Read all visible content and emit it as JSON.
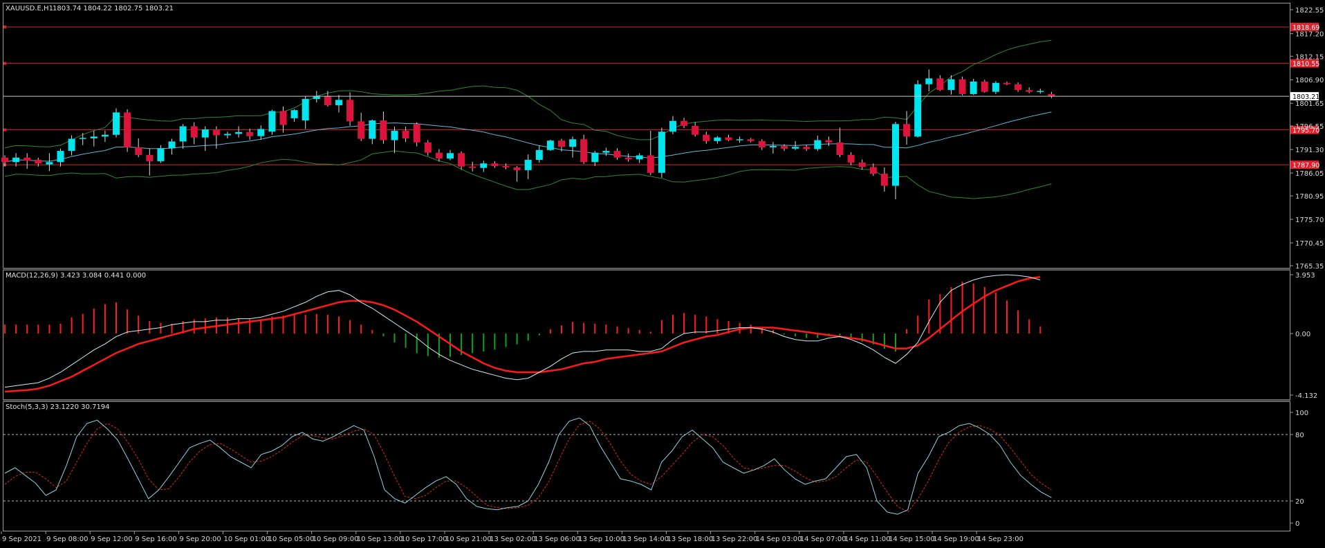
{
  "panels": {
    "main": {
      "symbol": "XAUUSD.E,H1",
      "ohlc": "1803.74 1804.22 1802.75 1803.21",
      "current_price_label": "1803.21",
      "price_scale": [
        "1822.55",
        "1817.20",
        "1812.15",
        "1806.90",
        "1801.65",
        "1796.55",
        "1791.30",
        "1786.05",
        "1780.95",
        "1775.70",
        "1770.45",
        "1765.35"
      ]
    },
    "macd": {
      "title": "MACD(12,26,9) 3.423 3.084 0.441 0.000",
      "scale": [
        "3.953",
        "0.00",
        "-4.132"
      ]
    },
    "stoch": {
      "title": "Stoch(5,3,3) 23.1220 30.7194",
      "scale": [
        "100",
        "80",
        "20",
        "0"
      ]
    },
    "time_axis": [
      "9 Sep 2021",
      "9 Sep 08:00",
      "9 Sep 12:00",
      "9 Sep 16:00",
      "9 Sep 20:00",
      "10 Sep 01:00",
      "10 Sep 05:00",
      "10 Sep 09:00",
      "10 Sep 13:00",
      "10 Sep 17:00",
      "10 Sep 21:00",
      "13 Sep 02:00",
      "13 Sep 06:00",
      "13 Sep 10:00",
      "13 Sep 14:00",
      "13 Sep 18:00",
      "13 Sep 22:00",
      "14 Sep 03:00",
      "14 Sep 07:00",
      "14 Sep 11:00",
      "14 Sep 15:00",
      "14 Sep 19:00",
      "14 Sep 23:00"
    ]
  },
  "colors": {
    "bull": "#00e5ee",
    "bear": "#dc143c",
    "hline": "#e0202a",
    "bands": "#2e8b2e",
    "ma": "#5fb8d8",
    "macd_pos": "#ff1e1e",
    "macd_neg": "#13a313",
    "signal": "#ff1a1a",
    "macd_line": "#cfeff5",
    "stoch_main": "#8fd6df",
    "stoch_signal": "#e02828",
    "grid_text": "#d8d8d8",
    "border": "#a0a0a0"
  },
  "chart_data": [
    {
      "type": "candlestick",
      "title": "XAUUSD.E,H1",
      "ylim": [
        1765.35,
        1822.55
      ],
      "horizontal_levels": [
        {
          "value": 1818.69,
          "label": "1818.69"
        },
        {
          "value": 1810.55,
          "label": "1810.55"
        },
        {
          "value": 1795.7,
          "label": "1795.70"
        },
        {
          "value": 1787.9,
          "label": "1787.90"
        }
      ],
      "candles": [
        {
          "o": 1789.5,
          "h": 1790.0,
          "l": 1787.5,
          "c": 1788.5
        },
        {
          "o": 1788.5,
          "h": 1790.5,
          "l": 1787.5,
          "c": 1789.5
        },
        {
          "o": 1789.5,
          "h": 1790.5,
          "l": 1787.0,
          "c": 1788.8
        },
        {
          "o": 1789.0,
          "h": 1789.5,
          "l": 1787.5,
          "c": 1788.2
        },
        {
          "o": 1788.0,
          "h": 1790.5,
          "l": 1786.5,
          "c": 1788.5
        },
        {
          "o": 1788.5,
          "h": 1791.5,
          "l": 1787.5,
          "c": 1791.0
        },
        {
          "o": 1791.0,
          "h": 1794.5,
          "l": 1790.0,
          "c": 1793.7
        },
        {
          "o": 1793.7,
          "h": 1795.0,
          "l": 1792.3,
          "c": 1793.9
        },
        {
          "o": 1793.8,
          "h": 1795.5,
          "l": 1792.0,
          "c": 1794.2
        },
        {
          "o": 1794.2,
          "h": 1795.5,
          "l": 1793.0,
          "c": 1794.6
        },
        {
          "o": 1794.6,
          "h": 1800.5,
          "l": 1794.0,
          "c": 1799.6
        },
        {
          "o": 1799.6,
          "h": 1800.3,
          "l": 1790.8,
          "c": 1791.8
        },
        {
          "o": 1791.8,
          "h": 1793.8,
          "l": 1789.6,
          "c": 1790.1
        },
        {
          "o": 1790.1,
          "h": 1791.5,
          "l": 1785.5,
          "c": 1788.7
        },
        {
          "o": 1788.7,
          "h": 1792.3,
          "l": 1788.3,
          "c": 1791.6
        },
        {
          "o": 1791.6,
          "h": 1793.7,
          "l": 1790.2,
          "c": 1793.1
        },
        {
          "o": 1793.1,
          "h": 1797.0,
          "l": 1791.5,
          "c": 1796.5
        },
        {
          "o": 1796.5,
          "h": 1797.4,
          "l": 1792.5,
          "c": 1794.0
        },
        {
          "o": 1794.0,
          "h": 1796.5,
          "l": 1791.0,
          "c": 1795.8
        },
        {
          "o": 1795.8,
          "h": 1796.5,
          "l": 1791.5,
          "c": 1794.5
        },
        {
          "o": 1794.5,
          "h": 1795.3,
          "l": 1793.8,
          "c": 1794.8
        },
        {
          "o": 1794.8,
          "h": 1796.5,
          "l": 1794.0,
          "c": 1795.2
        },
        {
          "o": 1795.2,
          "h": 1796.0,
          "l": 1793.5,
          "c": 1794.3
        },
        {
          "o": 1794.3,
          "h": 1796.7,
          "l": 1793.5,
          "c": 1795.9
        },
        {
          "o": 1795.3,
          "h": 1800.2,
          "l": 1794.6,
          "c": 1799.9
        },
        {
          "o": 1799.9,
          "h": 1800.9,
          "l": 1795.1,
          "c": 1796.8
        },
        {
          "o": 1798.3,
          "h": 1800.3,
          "l": 1797.5,
          "c": 1800.1
        },
        {
          "o": 1797.8,
          "h": 1803.2,
          "l": 1795.9,
          "c": 1802.6
        },
        {
          "o": 1802.6,
          "h": 1804.4,
          "l": 1801.8,
          "c": 1803.3
        },
        {
          "o": 1803.3,
          "h": 1804.4,
          "l": 1800.9,
          "c": 1801.2
        },
        {
          "o": 1801.2,
          "h": 1803.5,
          "l": 1799.6,
          "c": 1802.4
        },
        {
          "o": 1802.4,
          "h": 1804.1,
          "l": 1796.6,
          "c": 1797.6
        },
        {
          "o": 1797.6,
          "h": 1799.5,
          "l": 1793.2,
          "c": 1793.7
        },
        {
          "o": 1793.7,
          "h": 1798.0,
          "l": 1792.5,
          "c": 1797.8
        },
        {
          "o": 1797.8,
          "h": 1799.8,
          "l": 1792.6,
          "c": 1793.4
        },
        {
          "o": 1793.4,
          "h": 1796.4,
          "l": 1790.5,
          "c": 1795.5
        },
        {
          "o": 1795.5,
          "h": 1796.4,
          "l": 1793.0,
          "c": 1793.8
        },
        {
          "o": 1797.0,
          "h": 1797.4,
          "l": 1792.0,
          "c": 1792.9
        },
        {
          "o": 1792.9,
          "h": 1793.4,
          "l": 1789.9,
          "c": 1790.6
        },
        {
          "o": 1790.6,
          "h": 1791.4,
          "l": 1788.6,
          "c": 1789.3
        },
        {
          "o": 1789.3,
          "h": 1791.2,
          "l": 1788.9,
          "c": 1790.5
        },
        {
          "o": 1790.5,
          "h": 1790.9,
          "l": 1786.8,
          "c": 1787.5
        },
        {
          "o": 1787.5,
          "h": 1788.6,
          "l": 1786.4,
          "c": 1787.2
        },
        {
          "o": 1787.2,
          "h": 1788.8,
          "l": 1786.3,
          "c": 1788.2
        },
        {
          "o": 1788.2,
          "h": 1788.7,
          "l": 1787.2,
          "c": 1787.6
        },
        {
          "o": 1787.6,
          "h": 1788.2,
          "l": 1786.9,
          "c": 1787.3
        },
        {
          "o": 1787.3,
          "h": 1787.6,
          "l": 1784.1,
          "c": 1786.7
        },
        {
          "o": 1786.7,
          "h": 1790.2,
          "l": 1784.7,
          "c": 1789.0
        },
        {
          "o": 1789.0,
          "h": 1792.2,
          "l": 1788.4,
          "c": 1791.2
        },
        {
          "o": 1791.2,
          "h": 1793.5,
          "l": 1791.0,
          "c": 1793.3
        },
        {
          "o": 1793.3,
          "h": 1793.7,
          "l": 1790.9,
          "c": 1791.9
        },
        {
          "o": 1791.9,
          "h": 1794.2,
          "l": 1789.5,
          "c": 1793.6
        },
        {
          "o": 1793.6,
          "h": 1794.6,
          "l": 1788.1,
          "c": 1788.5
        },
        {
          "o": 1788.5,
          "h": 1791.0,
          "l": 1787.6,
          "c": 1790.6
        },
        {
          "o": 1790.6,
          "h": 1791.7,
          "l": 1789.9,
          "c": 1791.0
        },
        {
          "o": 1791.0,
          "h": 1791.6,
          "l": 1789.0,
          "c": 1789.5
        },
        {
          "o": 1789.5,
          "h": 1790.4,
          "l": 1788.6,
          "c": 1789.1
        },
        {
          "o": 1789.1,
          "h": 1790.5,
          "l": 1788.3,
          "c": 1790.0
        },
        {
          "o": 1790.0,
          "h": 1795.5,
          "l": 1785.6,
          "c": 1786.1
        },
        {
          "o": 1786.1,
          "h": 1796.2,
          "l": 1785.0,
          "c": 1795.3
        },
        {
          "o": 1795.3,
          "h": 1798.8,
          "l": 1794.7,
          "c": 1797.7
        },
        {
          "o": 1797.7,
          "h": 1798.4,
          "l": 1796.1,
          "c": 1796.6
        },
        {
          "o": 1796.6,
          "h": 1797.4,
          "l": 1794.2,
          "c": 1794.6
        },
        {
          "o": 1794.6,
          "h": 1795.3,
          "l": 1792.6,
          "c": 1793.2
        },
        {
          "o": 1793.2,
          "h": 1794.3,
          "l": 1792.6,
          "c": 1794.0
        },
        {
          "o": 1794.0,
          "h": 1794.6,
          "l": 1793.2,
          "c": 1793.4
        },
        {
          "o": 1793.4,
          "h": 1794.2,
          "l": 1792.8,
          "c": 1793.6
        },
        {
          "o": 1793.6,
          "h": 1793.9,
          "l": 1792.9,
          "c": 1793.2
        },
        {
          "o": 1793.2,
          "h": 1793.6,
          "l": 1791.2,
          "c": 1791.8
        },
        {
          "o": 1791.8,
          "h": 1793.0,
          "l": 1790.4,
          "c": 1792.1
        },
        {
          "o": 1792.1,
          "h": 1792.5,
          "l": 1791.0,
          "c": 1791.5
        },
        {
          "o": 1791.5,
          "h": 1793.2,
          "l": 1791.2,
          "c": 1791.9
        },
        {
          "o": 1791.9,
          "h": 1792.3,
          "l": 1791.0,
          "c": 1791.4
        },
        {
          "o": 1791.4,
          "h": 1794.4,
          "l": 1791.0,
          "c": 1793.4
        },
        {
          "o": 1793.4,
          "h": 1794.2,
          "l": 1792.1,
          "c": 1792.9
        },
        {
          "o": 1792.9,
          "h": 1796.2,
          "l": 1789.6,
          "c": 1790.1
        },
        {
          "o": 1790.1,
          "h": 1790.7,
          "l": 1787.8,
          "c": 1788.4
        },
        {
          "o": 1788.4,
          "h": 1789.1,
          "l": 1786.8,
          "c": 1787.4
        },
        {
          "o": 1787.4,
          "h": 1788.2,
          "l": 1785.4,
          "c": 1785.9
        },
        {
          "o": 1785.9,
          "h": 1787.3,
          "l": 1781.9,
          "c": 1783.2
        },
        {
          "o": 1783.2,
          "h": 1797.5,
          "l": 1780.2,
          "c": 1797.0
        },
        {
          "o": 1797.0,
          "h": 1799.9,
          "l": 1792.4,
          "c": 1794.2
        },
        {
          "o": 1794.2,
          "h": 1806.8,
          "l": 1794.0,
          "c": 1805.9
        },
        {
          "o": 1805.9,
          "h": 1809.2,
          "l": 1804.3,
          "c": 1807.2
        },
        {
          "o": 1807.2,
          "h": 1807.9,
          "l": 1804.4,
          "c": 1804.6
        },
        {
          "o": 1804.6,
          "h": 1807.9,
          "l": 1803.6,
          "c": 1807.0
        },
        {
          "o": 1807.0,
          "h": 1807.6,
          "l": 1803.4,
          "c": 1803.7
        },
        {
          "o": 1803.7,
          "h": 1807.1,
          "l": 1803.5,
          "c": 1806.5
        },
        {
          "o": 1806.5,
          "h": 1806.9,
          "l": 1804.0,
          "c": 1804.2
        },
        {
          "o": 1804.2,
          "h": 1806.6,
          "l": 1803.7,
          "c": 1806.2
        },
        {
          "o": 1806.2,
          "h": 1806.5,
          "l": 1805.7,
          "c": 1805.9
        },
        {
          "o": 1805.9,
          "h": 1806.3,
          "l": 1804.2,
          "c": 1804.6
        },
        {
          "o": 1804.6,
          "h": 1805.2,
          "l": 1803.9,
          "c": 1804.2
        },
        {
          "o": 1804.2,
          "h": 1804.9,
          "l": 1803.8,
          "c": 1804.4
        },
        {
          "o": 1803.7,
          "h": 1804.2,
          "l": 1802.8,
          "c": 1803.2
        }
      ],
      "bollinger": {
        "upper_start": 1796.0,
        "upper_mid": 1803.5,
        "upper_end": 1811.8,
        "lower_start": 1785.5,
        "lower_mid": 1784.0,
        "lower_end": 1782.5
      },
      "ma_line_end": 1794.0
    },
    {
      "type": "bar+line",
      "title": "MACD(12,26,9)",
      "ylim": [
        -4.132,
        3.953
      ],
      "histogram": [
        1.0,
        1.0,
        1.0,
        1.0,
        1.0,
        1.1,
        1.8,
        2.2,
        2.8,
        3.3,
        3.5,
        2.7,
        2.0,
        1.4,
        1.2,
        1.1,
        1.4,
        1.6,
        1.7,
        1.8,
        1.8,
        1.7,
        1.6,
        1.6,
        1.9,
        2.0,
        2.1,
        2.1,
        2.2,
        2.1,
        1.9,
        1.5,
        1.0,
        0.4,
        -0.3,
        -1.0,
        -1.6,
        -2.2,
        -2.5,
        -2.7,
        -2.6,
        -2.4,
        -2.2,
        -2.0,
        -1.8,
        -1.5,
        -1.2,
        -0.8,
        -0.2,
        0.5,
        0.9,
        1.3,
        1.2,
        1.1,
        1.0,
        0.8,
        0.6,
        0.4,
        0.2,
        1.5,
        2.1,
        2.3,
        2.1,
        1.9,
        1.6,
        1.4,
        1.2,
        1.0,
        0.7,
        0.4,
        -0.1,
        -0.3,
        -0.5,
        -0.5,
        -0.3,
        -0.2,
        -0.6,
        -0.9,
        -1.2,
        -1.7,
        -2.0,
        0.5,
        2.0,
        3.8,
        4.4,
        5.2,
        5.8,
        5.6,
        5.2,
        4.6,
        3.7,
        2.6,
        1.6,
        0.8
      ],
      "macd_line": [
        -3.6,
        -3.5,
        -3.4,
        -3.3,
        -3.0,
        -2.6,
        -2.1,
        -1.6,
        -1.1,
        -0.7,
        -0.2,
        0.1,
        0.2,
        0.3,
        0.4,
        0.6,
        0.7,
        0.8,
        0.8,
        0.9,
        0.9,
        1.0,
        1.0,
        1.1,
        1.3,
        1.5,
        1.8,
        2.1,
        2.5,
        2.8,
        2.9,
        2.6,
        2.1,
        1.7,
        1.2,
        0.7,
        0.2,
        -0.3,
        -0.9,
        -1.4,
        -1.8,
        -2.1,
        -2.4,
        -2.6,
        -2.8,
        -3.0,
        -3.1,
        -3.0,
        -2.6,
        -2.2,
        -1.7,
        -1.3,
        -1.2,
        -1.2,
        -1.1,
        -1.1,
        -1.1,
        -1.2,
        -1.2,
        -1.0,
        -0.4,
        0.0,
        0.1,
        0.1,
        0.2,
        0.3,
        0.4,
        0.4,
        0.3,
        0.1,
        -0.2,
        -0.4,
        -0.5,
        -0.5,
        -0.3,
        -0.2,
        -0.4,
        -0.7,
        -1.1,
        -1.6,
        -2.0,
        -1.4,
        -0.6,
        0.8,
        2.1,
        2.9,
        3.3,
        3.6,
        3.8,
        3.9,
        3.95,
        3.9,
        3.8,
        3.6
      ],
      "signal_line": [
        -3.9,
        -3.85,
        -3.8,
        -3.7,
        -3.5,
        -3.2,
        -2.9,
        -2.5,
        -2.1,
        -1.7,
        -1.3,
        -1.0,
        -0.7,
        -0.5,
        -0.3,
        -0.1,
        0.1,
        0.3,
        0.4,
        0.5,
        0.6,
        0.7,
        0.8,
        0.9,
        1.0,
        1.1,
        1.3,
        1.5,
        1.7,
        1.9,
        2.1,
        2.2,
        2.2,
        2.1,
        1.9,
        1.6,
        1.2,
        0.8,
        0.3,
        -0.2,
        -0.7,
        -1.2,
        -1.6,
        -2.0,
        -2.3,
        -2.5,
        -2.6,
        -2.6,
        -2.6,
        -2.5,
        -2.4,
        -2.2,
        -2.0,
        -1.9,
        -1.7,
        -1.6,
        -1.5,
        -1.4,
        -1.3,
        -1.2,
        -0.9,
        -0.6,
        -0.4,
        -0.2,
        -0.1,
        0.1,
        0.3,
        0.4,
        0.4,
        0.4,
        0.3,
        0.2,
        0.1,
        0.0,
        -0.1,
        -0.2,
        -0.3,
        -0.4,
        -0.6,
        -0.8,
        -1.0,
        -1.0,
        -0.8,
        -0.3,
        0.3,
        0.9,
        1.5,
        2.0,
        2.5,
        2.9,
        3.2,
        3.5,
        3.7,
        3.8
      ]
    },
    {
      "type": "line",
      "title": "Stoch(5,3,3)",
      "ylim": [
        0,
        100
      ],
      "levels": [
        80,
        20
      ],
      "main": [
        45,
        50,
        43,
        36,
        25,
        30,
        52,
        78,
        90,
        93,
        85,
        75,
        58,
        40,
        22,
        30,
        42,
        55,
        68,
        72,
        75,
        68,
        60,
        55,
        50,
        62,
        65,
        70,
        78,
        82,
        76,
        74,
        78,
        83,
        88,
        84,
        60,
        30,
        22,
        18,
        25,
        32,
        38,
        42,
        35,
        22,
        15,
        13,
        12,
        14,
        15,
        20,
        35,
        55,
        80,
        92,
        95,
        88,
        70,
        55,
        40,
        38,
        35,
        30,
        55,
        65,
        78,
        84,
        76,
        68,
        55,
        50,
        45,
        48,
        52,
        58,
        48,
        40,
        35,
        38,
        40,
        50,
        60,
        62,
        50,
        20,
        10,
        8,
        12,
        45,
        60,
        78,
        82,
        88,
        90,
        86,
        80,
        70,
        55,
        43,
        35,
        28,
        23
      ],
      "signal": [
        35,
        42,
        46,
        46,
        40,
        32,
        38,
        55,
        72,
        85,
        90,
        85,
        73,
        58,
        40,
        30,
        31,
        42,
        55,
        65,
        71,
        72,
        67,
        61,
        55,
        56,
        60,
        66,
        73,
        79,
        79,
        77,
        76,
        79,
        83,
        85,
        80,
        62,
        42,
        24,
        22,
        25,
        32,
        38,
        38,
        32,
        24,
        16,
        14,
        13,
        14,
        16,
        23,
        37,
        57,
        76,
        89,
        92,
        85,
        72,
        56,
        44,
        38,
        35,
        42,
        52,
        62,
        73,
        80,
        78,
        70,
        59,
        50,
        48,
        50,
        52,
        52,
        47,
        41,
        37,
        38,
        42,
        50,
        57,
        55,
        42,
        28,
        15,
        10,
        22,
        38,
        57,
        73,
        82,
        87,
        88,
        85,
        79,
        68,
        56,
        44,
        36,
        30
      ]
    }
  ]
}
